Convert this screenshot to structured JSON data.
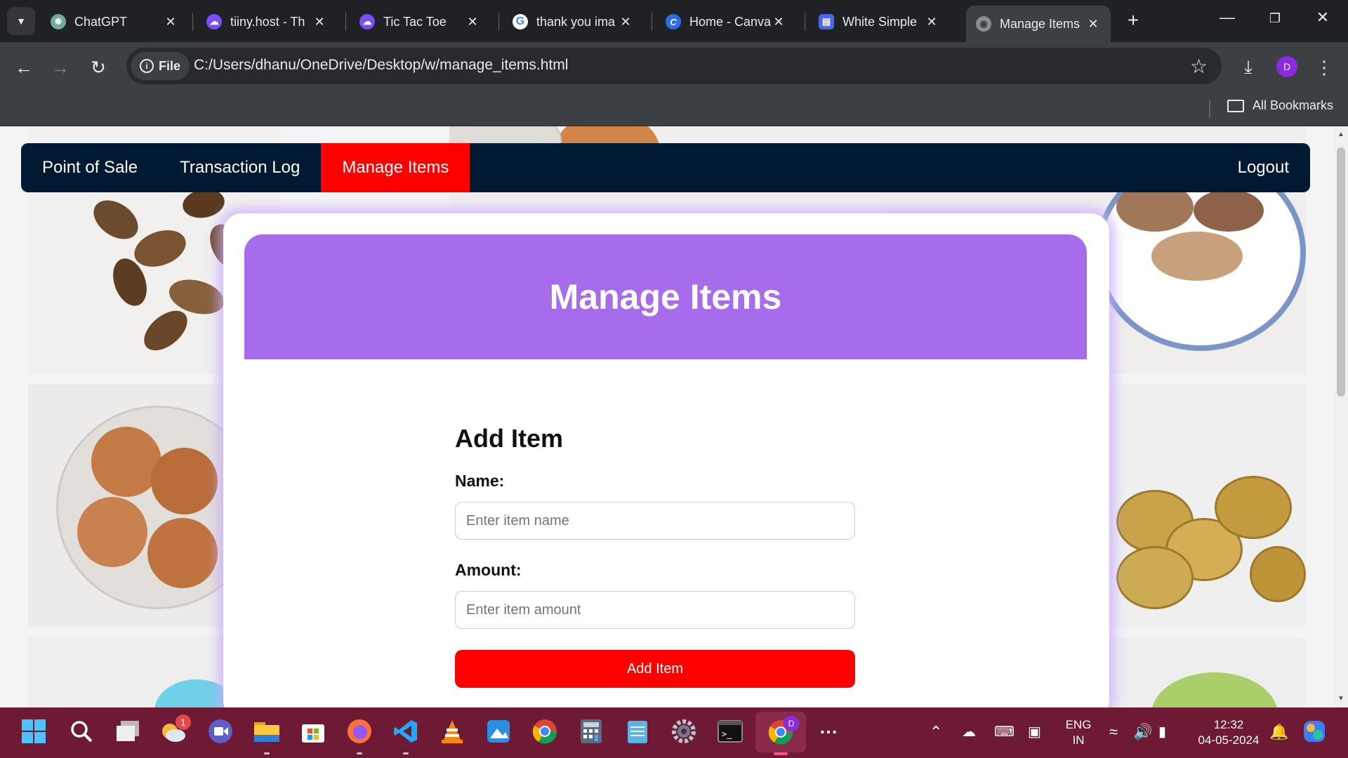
{
  "browser": {
    "tabs": [
      {
        "title": "ChatGPT",
        "icon": "chatgpt-icon",
        "color": "#74aa9c"
      },
      {
        "title": "tiiny.host - Th",
        "icon": "tiiny-host-icon",
        "color": "#7c4dff"
      },
      {
        "title": "Tic Tac Toe",
        "icon": "tiiny-host-icon",
        "color": "#7c4dff"
      },
      {
        "title": "thank you ima",
        "icon": "google-icon",
        "color": "#ffffff"
      },
      {
        "title": "Home - Canva",
        "icon": "canva-icon",
        "color": "#2b6ee6"
      },
      {
        "title": "White Simple",
        "icon": "doc-icon",
        "color": "#4a66f0"
      },
      {
        "title": "Manage Items",
        "icon": "globe-icon",
        "color": "#8a8d91",
        "active": true
      }
    ],
    "new_tab_symbol": "+",
    "address": {
      "chip_label": "File",
      "url": "C:/Users/dhanu/OneDrive/Desktop/w/manage_items.html"
    },
    "profile_initial": "D",
    "bookmarks_label": "All Bookmarks"
  },
  "app": {
    "nav": {
      "links": [
        "Point of Sale",
        "Transaction Log",
        "Manage Items"
      ],
      "active": "Manage Items",
      "logout": "Logout"
    },
    "header_title": "Manage Items",
    "form": {
      "heading": "Add Item",
      "name_label": "Name:",
      "name_placeholder": "Enter item name",
      "amount_label": "Amount:",
      "amount_placeholder": "Enter item amount",
      "submit_label": "Add Item"
    },
    "colors": {
      "nav_bg": "#001a33",
      "active_nav": "#ff0000",
      "header_bg": "#a66cec",
      "button_bg": "#ff0000"
    }
  },
  "taskbar": {
    "apps": [
      "start-icon",
      "search-icon",
      "task-view-icon",
      "widgets-icon",
      "meet-icon",
      "file-explorer-icon",
      "store-icon",
      "firefox-icon",
      "vscode-icon",
      "vlc-icon",
      "photos-icon",
      "chrome-icon",
      "calculator-icon",
      "notepad-icon",
      "settings-icon",
      "terminal-icon",
      "chrome-profile-icon",
      "more-icon"
    ],
    "widgets_badge": "1",
    "chrome_profile_initial": "D",
    "language": "ENG",
    "region": "IN",
    "time": "12:32",
    "date": "04-05-2024"
  }
}
